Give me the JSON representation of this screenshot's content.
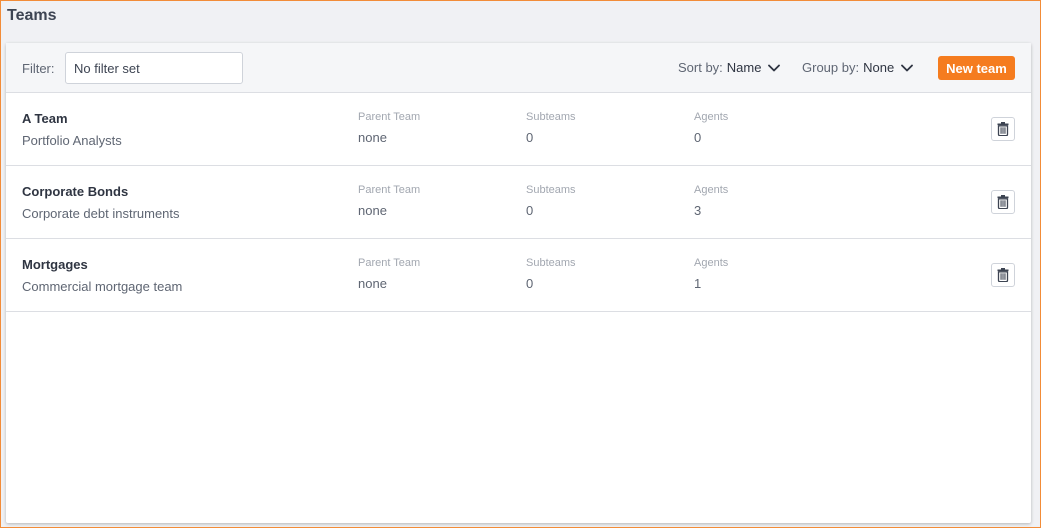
{
  "page": {
    "title": "Teams"
  },
  "toolbar": {
    "filter_label": "Filter:",
    "filter_placeholder": "No filter set",
    "filter_value": "",
    "sort_label": "Sort by:",
    "sort_value": "Name",
    "group_label": "Group by:",
    "group_value": "None",
    "new_team_label": "New team",
    "accent_color": "#f57c1f"
  },
  "columns": {
    "parent": "Parent Team",
    "subteams": "Subteams",
    "agents": "Agents"
  },
  "teams": [
    {
      "name": "A Team",
      "description": "Portfolio Analysts",
      "parent": "none",
      "subteams": "0",
      "agents": "0"
    },
    {
      "name": "Corporate Bonds",
      "description": "Corporate debt instruments",
      "parent": "none",
      "subteams": "0",
      "agents": "3"
    },
    {
      "name": "Mortgages",
      "description": "Commercial mortgage team",
      "parent": "none",
      "subteams": "0",
      "agents": "1"
    }
  ],
  "icons": {
    "dropdown": "chevron-down-icon",
    "delete": "trash-icon"
  }
}
